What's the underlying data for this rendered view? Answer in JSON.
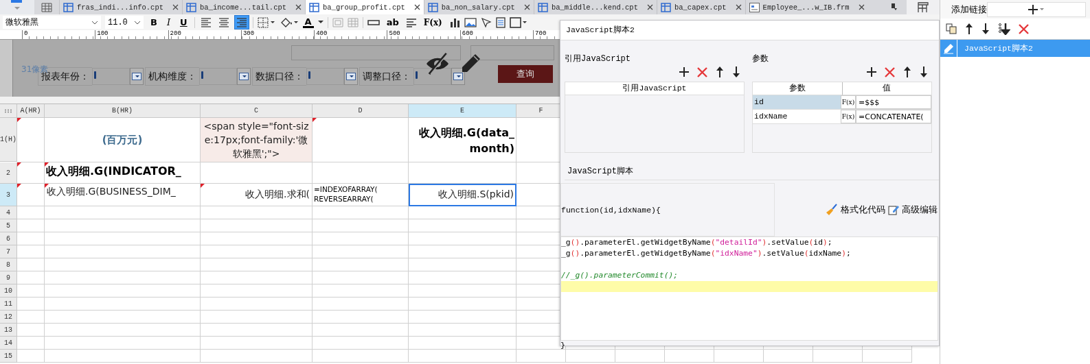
{
  "tabs": [
    {
      "label": "fras_indi...info.cpt",
      "kind": "report",
      "selected": false
    },
    {
      "label": "ba_income...tail.cpt",
      "kind": "report",
      "selected": false
    },
    {
      "label": "ba_group_profit.cpt",
      "kind": "report",
      "selected": true
    },
    {
      "label": "ba_non_salary.cpt",
      "kind": "report",
      "selected": false
    },
    {
      "label": "ba_middle...kend.cpt",
      "kind": "report",
      "selected": false
    },
    {
      "label": "ba_capex.cpt",
      "kind": "report",
      "selected": false
    },
    {
      "label": "Employee_...w_IB.frm",
      "kind": "form",
      "selected": false
    }
  ],
  "toolbar": {
    "font": "微软雅黑",
    "size": "11.0",
    "styles": [
      {
        "label": "B",
        "selected": false
      },
      {
        "label": "I",
        "selected": false
      },
      {
        "label": "U",
        "selected": false
      }
    ],
    "alignment": [
      {
        "selected": false
      },
      {
        "selected": false
      },
      {
        "selected": true
      }
    ],
    "font_color_label": "A",
    "text_label": "ab",
    "formula_label": "F(x)"
  },
  "ruler": [
    "0",
    "100",
    "200",
    "300",
    "400",
    "500",
    "600",
    "700"
  ],
  "parameter_pane": {
    "height_label": "31像素",
    "fields": [
      {
        "label": "报表年份："
      },
      {
        "label": "机构维度："
      },
      {
        "label": "数据口径："
      },
      {
        "label": "调整口径："
      }
    ],
    "query_button": "查询"
  },
  "sheet": {
    "columns": [
      {
        "label": "A(HR)",
        "selected": false
      },
      {
        "label": "B(HR)",
        "selected": false
      },
      {
        "label": "C",
        "selected": false
      },
      {
        "label": "D",
        "selected": false
      },
      {
        "label": "E",
        "selected": true
      },
      {
        "label": "F",
        "selected": false
      }
    ],
    "rows": [
      {
        "label": "1(H)",
        "selected": false,
        "cells": [
          {
            "kind": "empty",
            "flagged": true,
            "selected": false
          },
          {
            "kind": "unit",
            "text": "(百万元)",
            "flagged": false,
            "selected": false
          },
          {
            "kind": "markup",
            "text": "<span style=\"font-size:17px;font-family:'微软雅黑';\">",
            "flagged": false,
            "selected": false
          },
          {
            "kind": "empty",
            "flagged": true,
            "selected": false
          },
          {
            "kind": "heading-right",
            "text": "收入明细.G(data_month)",
            "flagged": false,
            "selected": false
          },
          {
            "kind": "empty",
            "flagged": false,
            "selected": false
          }
        ]
      },
      {
        "label": "2",
        "selected": false,
        "cells": [
          {
            "kind": "empty",
            "flagged": true,
            "selected": false
          },
          {
            "kind": "heading",
            "text": "收入明细.G(INDICATOR_",
            "flagged": true,
            "selected": false
          },
          {
            "kind": "empty",
            "flagged": false,
            "selected": false
          },
          {
            "kind": "empty",
            "flagged": false,
            "selected": false
          },
          {
            "kind": "empty",
            "flagged": false,
            "selected": false
          },
          {
            "kind": "empty",
            "flagged": false,
            "selected": false
          }
        ]
      },
      {
        "label": "3",
        "selected": true,
        "cells": [
          {
            "kind": "empty",
            "flagged": true,
            "selected": false
          },
          {
            "kind": "field",
            "text": "收入明细.G(BUSINESS_DIM_",
            "flagged": true,
            "selected": false
          },
          {
            "kind": "total",
            "text": "收入明细.求和(",
            "flagged": true,
            "selected": false
          },
          {
            "kind": "formula",
            "text": "=INDEXOFARRAY( REVERSEARRAY(",
            "flagged": false,
            "selected": false
          },
          {
            "kind": "total",
            "text": "收入明细.S(pkid)",
            "flagged": false,
            "selected": true
          },
          {
            "kind": "empty",
            "flagged": false,
            "selected": false
          }
        ]
      },
      {
        "label": "4",
        "selected": false
      },
      {
        "label": "5",
        "selected": false
      },
      {
        "label": "6",
        "selected": false
      },
      {
        "label": "7",
        "selected": false
      },
      {
        "label": "8",
        "selected": false
      },
      {
        "label": "9",
        "selected": false
      },
      {
        "label": "10",
        "selected": false
      },
      {
        "label": "11",
        "selected": false
      },
      {
        "label": "12",
        "selected": false
      },
      {
        "label": "13",
        "selected": false
      },
      {
        "label": "14",
        "selected": false
      },
      {
        "label": "15",
        "selected": false
      }
    ]
  },
  "dialog": {
    "title": "JavaScript脚本2",
    "imports": {
      "title": "引用JavaScript",
      "column": "引用JavaScript"
    },
    "parameters": {
      "title": "参数",
      "columns": [
        "参数",
        "值"
      ],
      "rows": [
        {
          "name": "id",
          "formula_label": "F(x)",
          "value": "=$$$",
          "selected": true
        },
        {
          "name": "idxName",
          "formula_label": "F(x)",
          "value": "=CONCATENATE(",
          "selected": false
        }
      ]
    },
    "script": {
      "title": "JavaScript脚本",
      "signature": "function(id,idxName){",
      "format_button": "格式化代码",
      "advanced_button": "高级编辑",
      "lines": [
        {
          "current": false,
          "tokens": [
            {
              "kind": "plain",
              "text": "_g"
            },
            {
              "kind": "paren",
              "text": "()"
            },
            {
              "kind": "plain",
              "text": ".parameterEl.getWidgetByName"
            },
            {
              "kind": "paren",
              "text": "("
            },
            {
              "kind": "string",
              "text": "\"detailId\""
            },
            {
              "kind": "paren",
              "text": ")"
            },
            {
              "kind": "plain",
              "text": ".setValue"
            },
            {
              "kind": "paren",
              "text": "("
            },
            {
              "kind": "plain",
              "text": "id"
            },
            {
              "kind": "paren",
              "text": ")"
            },
            {
              "kind": "plain",
              "text": ";"
            }
          ]
        },
        {
          "current": false,
          "tokens": [
            {
              "kind": "plain",
              "text": "_g"
            },
            {
              "kind": "paren",
              "text": "()"
            },
            {
              "kind": "plain",
              "text": ".parameterEl.getWidgetByName"
            },
            {
              "kind": "paren",
              "text": "("
            },
            {
              "kind": "string",
              "text": "\"idxName\""
            },
            {
              "kind": "paren",
              "text": ")"
            },
            {
              "kind": "plain",
              "text": ".setValue"
            },
            {
              "kind": "paren",
              "text": "("
            },
            {
              "kind": "plain",
              "text": "idxName"
            },
            {
              "kind": "paren",
              "text": ")"
            },
            {
              "kind": "plain",
              "text": ";"
            }
          ]
        },
        {
          "current": false
        },
        {
          "current": false,
          "tokens": [
            {
              "kind": "comment",
              "text": "//_g().parameterCommit();"
            }
          ]
        },
        {
          "current": true
        }
      ],
      "closing": "}"
    }
  },
  "links_panel": {
    "title": "添加链接",
    "items": [
      {
        "label": "JavaScript脚本2",
        "selected": true
      }
    ]
  }
}
